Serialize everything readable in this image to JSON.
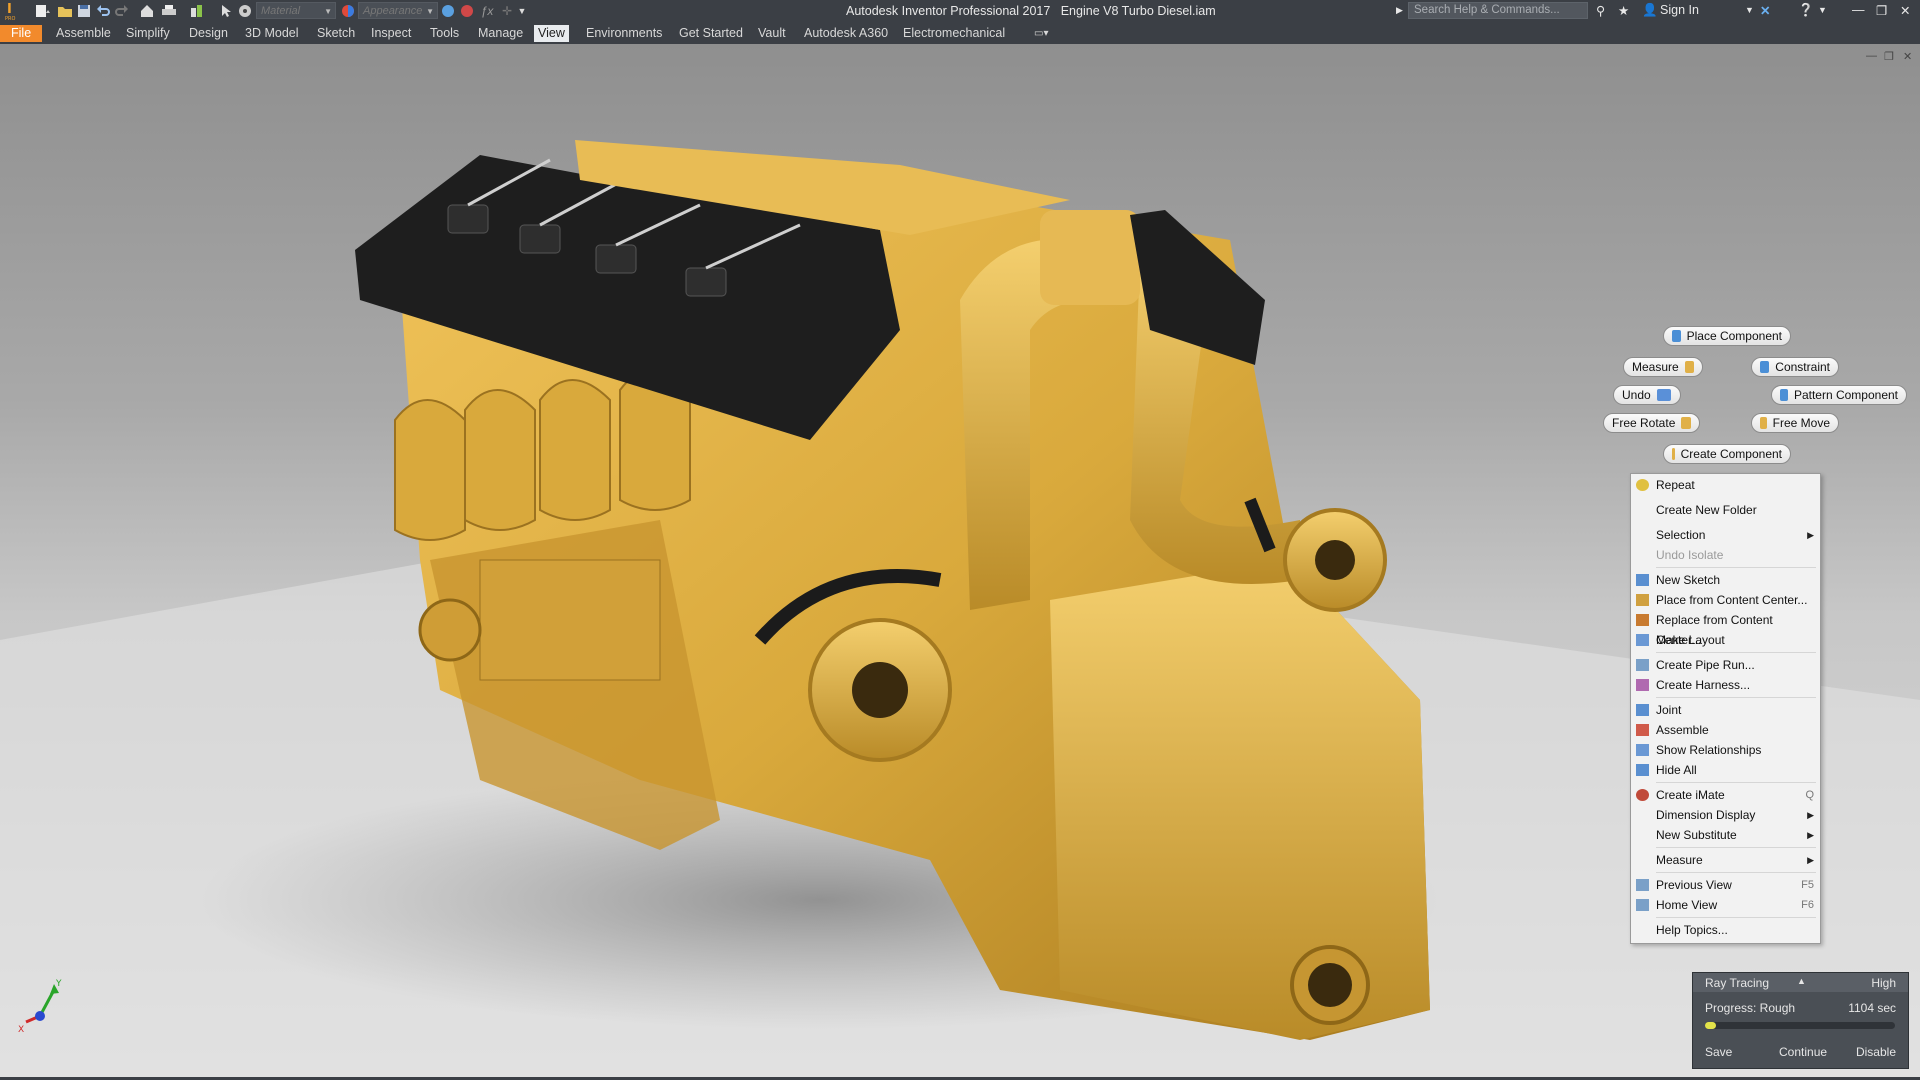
{
  "window": {
    "app_title": "Autodesk Inventor Professional 2017",
    "document_title": "Engine V8 Turbo Diesel.iam",
    "search_placeholder": "Search Help & Commands...",
    "sign_in": "Sign In"
  },
  "quick_access": {
    "material_placeholder": "Material",
    "appearance_placeholder": "Appearance"
  },
  "ribbon": {
    "tabs": [
      "File",
      "Assemble",
      "Simplify",
      "Design",
      "3D Model",
      "Sketch",
      "Inspect",
      "Tools",
      "Manage",
      "View",
      "Environments",
      "Get Started",
      "Vault",
      "Autodesk A360",
      "Electromechanical"
    ],
    "active_tab": "View"
  },
  "marking_menu": {
    "north": "Place Component",
    "northwest": "Measure",
    "northeast": "Constraint",
    "west": "Undo",
    "east": "Pattern Component",
    "southwest": "Free Rotate",
    "southeast": "Free Move",
    "south": "Create Component"
  },
  "context_menu": {
    "items": [
      {
        "label": "Repeat",
        "icon": "repeat-icon"
      },
      {
        "label": "Create New Folder"
      },
      {
        "label": "Selection",
        "submenu": true
      },
      {
        "label": "Undo Isolate",
        "disabled": true
      },
      {
        "label": "New Sketch",
        "icon": "sketch-icon"
      },
      {
        "label": "Place from Content Center...",
        "icon": "content-center-icon"
      },
      {
        "label": "Replace from Content Center...",
        "icon": "replace-icon"
      },
      {
        "label": "Make Layout",
        "icon": "layout-icon"
      },
      {
        "label": "Create Pipe Run...",
        "icon": "pipe-icon"
      },
      {
        "label": "Create Harness...",
        "icon": "harness-icon"
      },
      {
        "label": "Joint",
        "icon": "joint-icon"
      },
      {
        "label": "Assemble",
        "icon": "assemble-icon"
      },
      {
        "label": "Show Relationships",
        "icon": "relationships-icon"
      },
      {
        "label": "Hide All",
        "icon": "hide-all-icon"
      },
      {
        "label": "Create iMate",
        "icon": "imate-icon",
        "shortcut": "Q"
      },
      {
        "label": "Dimension Display",
        "submenu": true
      },
      {
        "label": "New Substitute",
        "submenu": true
      },
      {
        "label": "Measure",
        "submenu": true
      },
      {
        "label": "Previous View",
        "icon": "previous-view-icon",
        "shortcut": "F5"
      },
      {
        "label": "Home View",
        "icon": "home-view-icon",
        "shortcut": "F6"
      },
      {
        "label": "Help Topics..."
      }
    ]
  },
  "ray_tracing": {
    "title": "Ray Tracing",
    "quality": "High",
    "progress_label": "Progress: Rough",
    "time": "1104 sec",
    "progress_fraction": 0.06,
    "save": "Save",
    "continue": "Continue",
    "disable": "Disable"
  },
  "colors": {
    "file_tab": "#f28a2c",
    "engine": "#d9a93c",
    "valve_covers": "#1e1e1e",
    "progress": "#e3e34a"
  }
}
